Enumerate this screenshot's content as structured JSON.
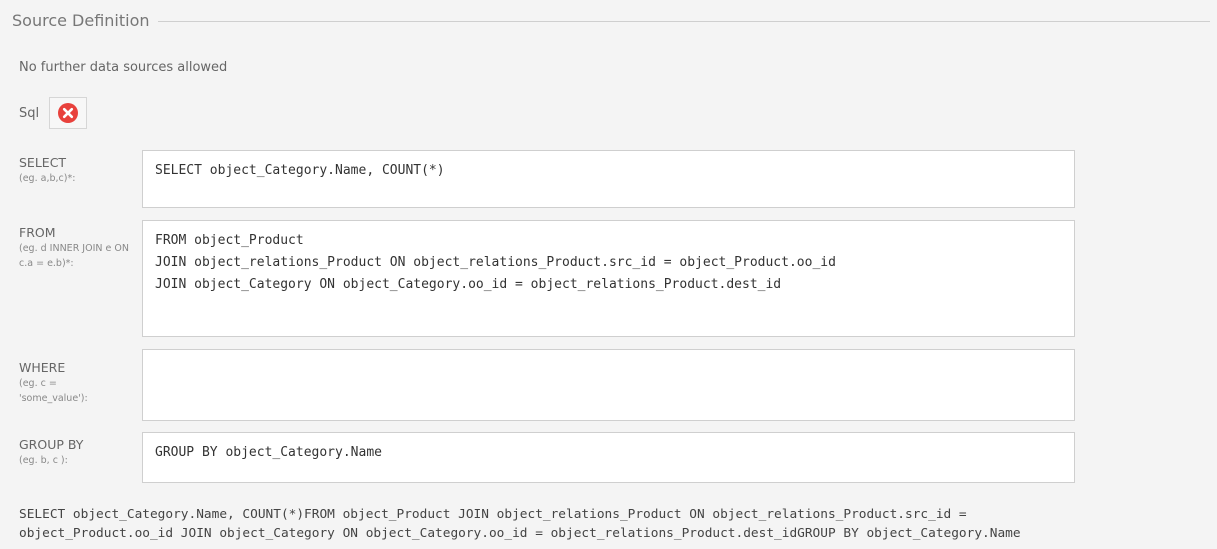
{
  "fieldset": {
    "legend": "Source Definition"
  },
  "notice": "No further data sources allowed",
  "source": {
    "label": "Sql",
    "remove_icon": "close-circle-icon",
    "accent": "#e8413c"
  },
  "fields": {
    "select": {
      "label": "SELECT",
      "hint": "(eg. a,b,c)*:",
      "value": "SELECT object_Category.Name, COUNT(*)"
    },
    "from": {
      "label": "FROM",
      "hint": "(eg. d INNER JOIN e ON c.a = e.b)*:",
      "value": "FROM object_Product\nJOIN object_relations_Product ON object_relations_Product.src_id = object_Product.oo_id\nJOIN object_Category ON object_Category.oo_id = object_relations_Product.dest_id"
    },
    "where": {
      "label": "WHERE",
      "hint": "(eg. c = 'some_value'):",
      "value": ""
    },
    "groupby": {
      "label": "GROUP BY",
      "hint": "(eg. b, c ):",
      "value": "GROUP BY object_Category.Name"
    }
  },
  "preview": "SELECT object_Category.Name, COUNT(*)FROM object_Product JOIN object_relations_Product ON object_relations_Product.src_id =\nobject_Product.oo_id JOIN object_Category ON object_Category.oo_id = object_relations_Product.dest_idGROUP BY object_Category.Name"
}
